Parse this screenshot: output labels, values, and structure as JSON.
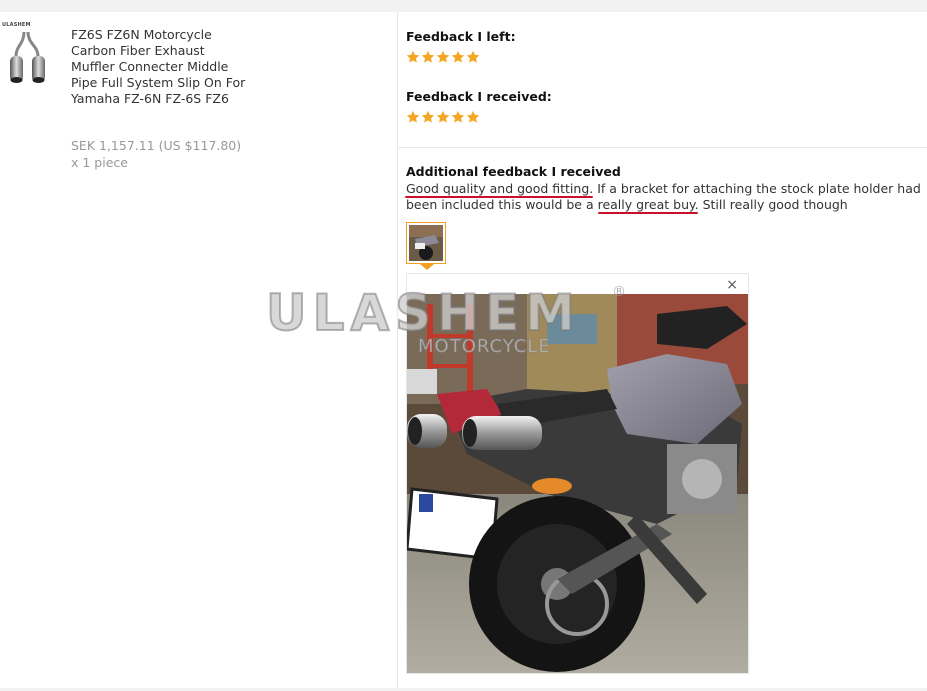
{
  "product": {
    "thumb_brand": "ULASHEM",
    "title": "FZ6S FZ6N Motorcycle Carbon Fiber Exhaust Muffler Connecter Middle Pipe Full System Slip On For Yamaha FZ-6N FZ-6S FZ6",
    "price": "SEK 1,157.11 (US $117.80)",
    "quantity": "x 1 piece"
  },
  "feedback": {
    "left_label": "Feedback I left:",
    "left_stars": 5,
    "received_label": "Feedback I received:",
    "received_stars": 5,
    "additional_label": "Additional feedback I received",
    "review_line1": "Good quality and good fitting. If a bracket for attaching the stock plate holder had",
    "review_line2": "been included this would be a really great buy. Still really good though",
    "star_color": "#f5a623"
  },
  "viewer": {
    "close_label": "×"
  },
  "watermark": {
    "main": "ULASHEM",
    "sub": "MOTORCYCLE",
    "reg": "®"
  }
}
